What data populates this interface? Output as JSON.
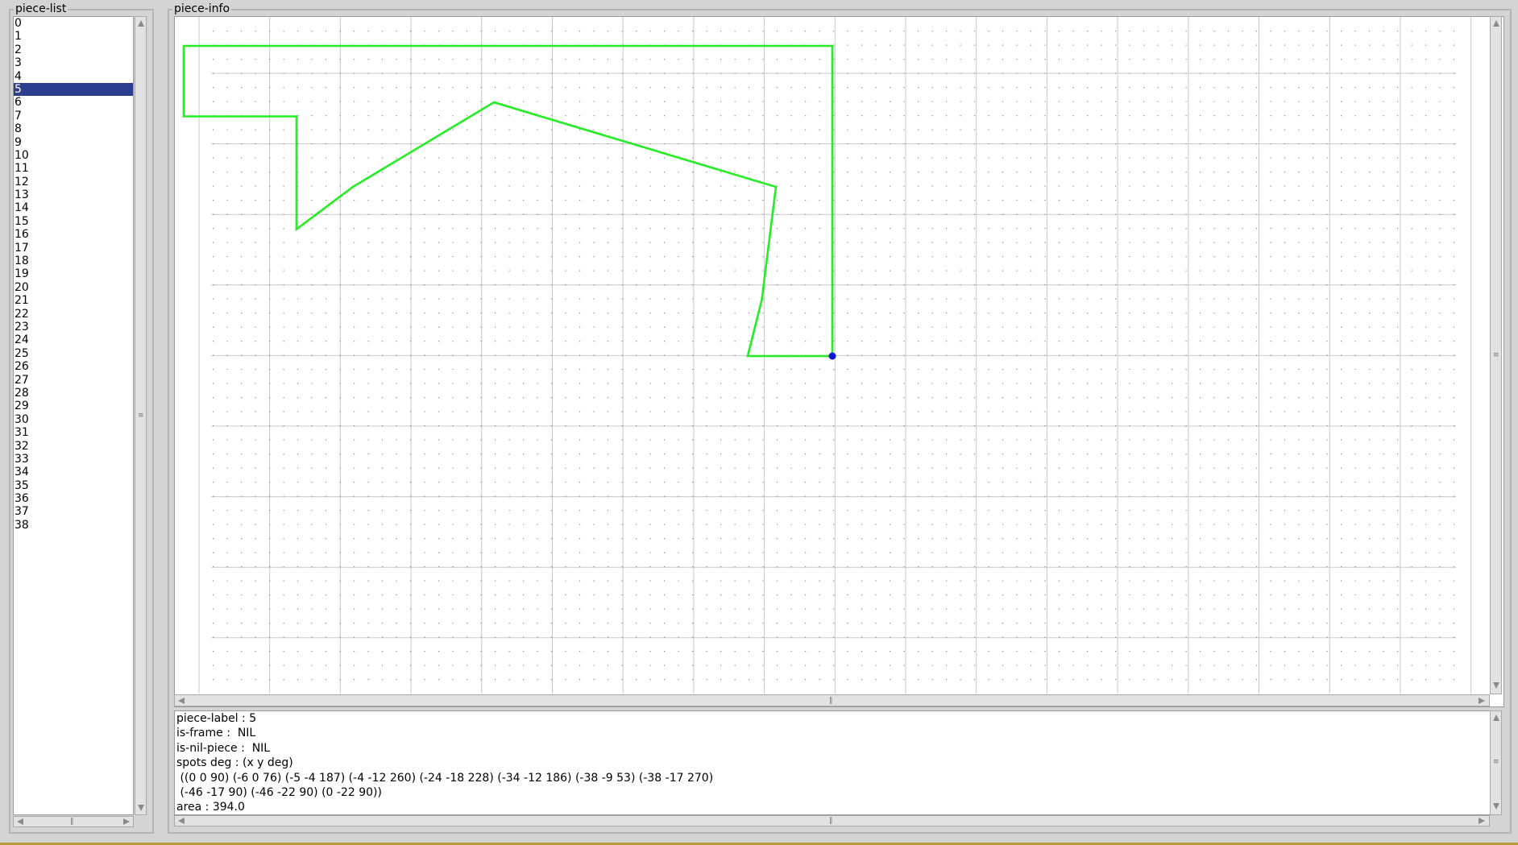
{
  "piece_list": {
    "title": "piece-list",
    "selected": "5",
    "items": [
      "0",
      "1",
      "2",
      "3",
      "4",
      "5",
      "6",
      "7",
      "8",
      "9",
      "10",
      "11",
      "12",
      "13",
      "14",
      "15",
      "16",
      "17",
      "18",
      "19",
      "20",
      "21",
      "22",
      "23",
      "24",
      "25",
      "26",
      "27",
      "28",
      "29",
      "30",
      "31",
      "32",
      "33",
      "34",
      "35",
      "36",
      "37",
      "38"
    ]
  },
  "piece_info": {
    "title": "piece-info",
    "shape": {
      "stroke_color": "#22ee22",
      "spot_color": "#0b14d6",
      "grid_line_color": "#c8c8c8",
      "grid_dot_color": "#8a8a8a",
      "spots": [
        [
          0,
          0
        ],
        [
          -6,
          0
        ],
        [
          -5,
          -4
        ],
        [
          -4,
          -12
        ],
        [
          -24,
          -18
        ],
        [
          -34,
          -12
        ],
        [
          -38,
          -9
        ],
        [
          -38,
          -17
        ],
        [
          -46,
          -17
        ],
        [
          -46,
          -22
        ],
        [
          0,
          -22
        ]
      ]
    },
    "text_lines": [
      "piece-label : 5",
      "is-frame :  NIL",
      "is-nil-piece :  NIL",
      "spots deg : (x y deg)",
      " ((0 0 90) (-6 0 76) (-5 -4 187) (-4 -12 260) (-24 -18 228) (-34 -12 186) (-38 -9 53) (-38 -17 270)",
      " (-46 -17 90) (-46 -22 90) (0 -22 90))",
      "area : 394.0"
    ]
  },
  "colors": {
    "selection": "#2b3f8e",
    "window_bg": "#d4d4d4"
  }
}
